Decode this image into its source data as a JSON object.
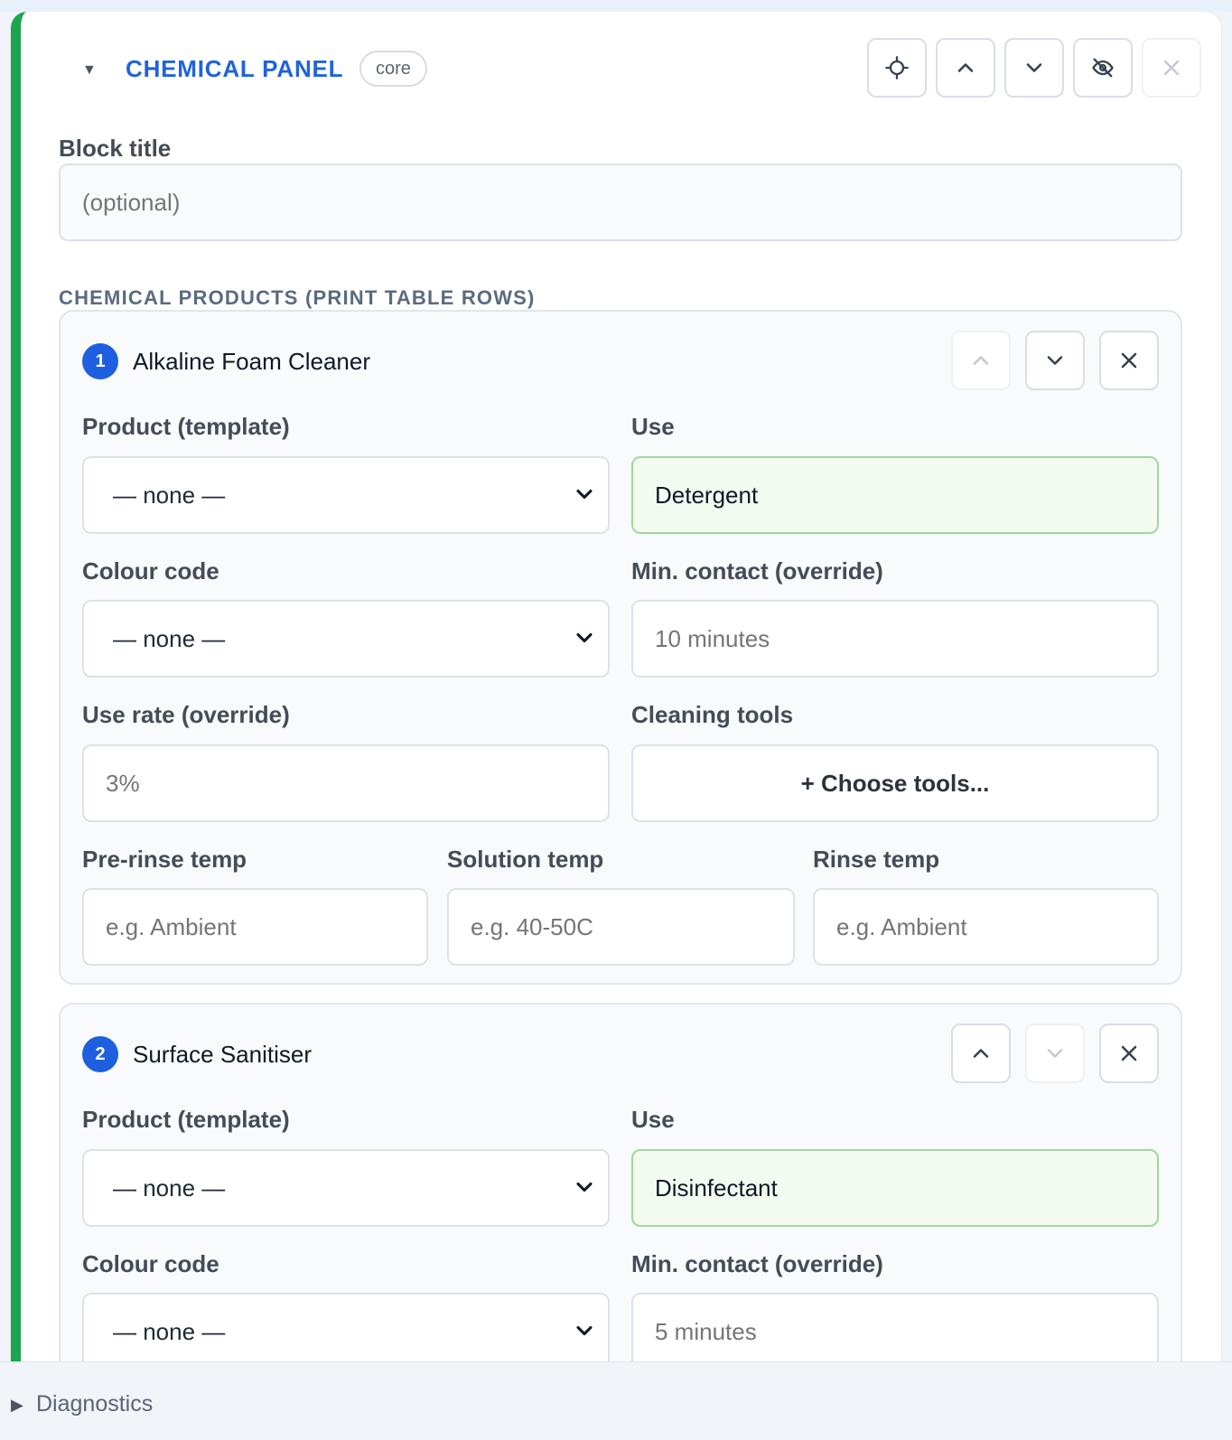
{
  "block": {
    "title": "CHEMICAL PANEL",
    "badge": "core",
    "block_title_label": "Block title",
    "block_title_placeholder": "(optional)",
    "section_label": "CHEMICAL PRODUCTS (PRINT TABLE ROWS)",
    "accent_color": "#1aa64f",
    "title_color": "#1f63dc"
  },
  "header_buttons": [
    "crosshair-icon",
    "chevron-up-icon",
    "chevron-down-icon",
    "eye-off-icon",
    "close-icon"
  ],
  "labels": {
    "product_template": "Product (template)",
    "use": "Use",
    "colour_code": "Colour code",
    "min_contact": "Min. contact (override)",
    "use_rate": "Use rate (override)",
    "cleaning_tools": "Cleaning tools",
    "pre_rinse": "Pre-rinse temp",
    "solution": "Solution temp",
    "rinse": "Rinse temp",
    "choose_tools": "+ Choose tools..."
  },
  "products": [
    {
      "index": "1",
      "name": "Alkaline Foam Cleaner",
      "product_template": "— none —",
      "use": "Detergent",
      "colour_code": "— none —",
      "min_contact_placeholder": "10 minutes",
      "use_rate_placeholder": "3%",
      "pre_rinse_placeholder": "e.g. Ambient",
      "solution_placeholder": "e.g. 40-50C",
      "rinse_placeholder": "e.g. Ambient"
    },
    {
      "index": "2",
      "name": "Surface Sanitiser",
      "product_template": "— none —",
      "use": "Disinfectant",
      "colour_code": "— none —",
      "min_contact_placeholder": "5 minutes"
    }
  ],
  "footer": {
    "label": "Diagnostics"
  }
}
